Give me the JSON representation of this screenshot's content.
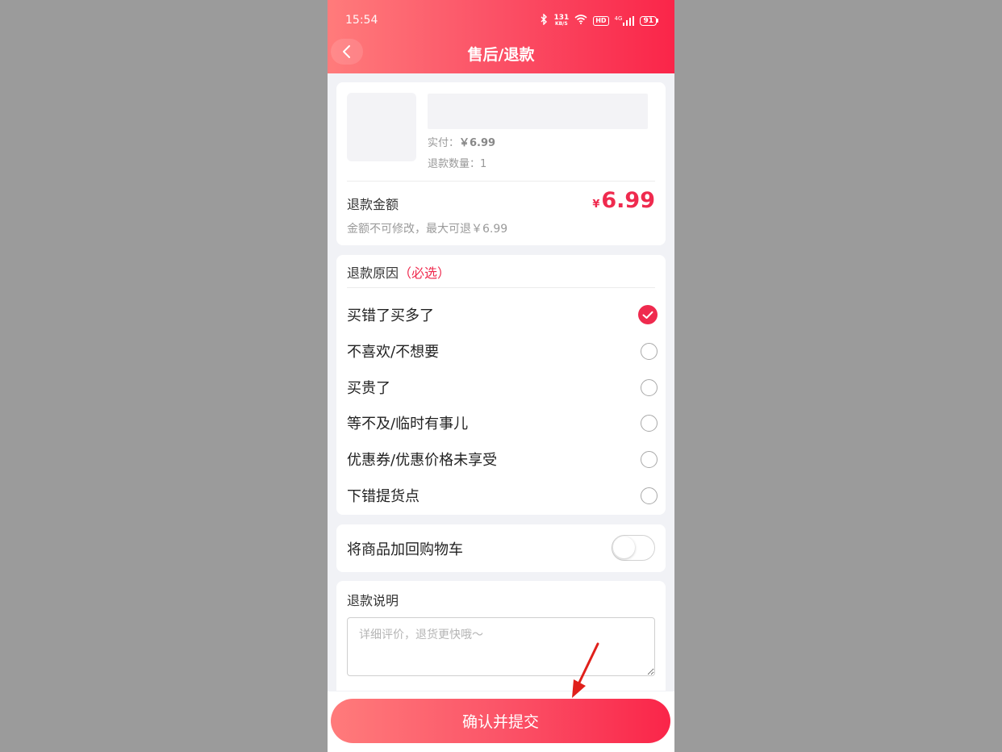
{
  "status_bar": {
    "time": "15:54",
    "net_speed": "131",
    "net_unit": "KB/S",
    "hd": "HD",
    "signal": "4G",
    "battery": "91"
  },
  "header": {
    "title": "售后/退款",
    "back_icon": "chevron-left-icon"
  },
  "product": {
    "paid_label": "实付：",
    "paid_value": "￥6.99",
    "qty_label": "退款数量：",
    "qty_value": "1"
  },
  "refund": {
    "label": "退款金额",
    "currency": "¥",
    "amount": "6.99",
    "note": "金额不可修改，最大可退￥6.99"
  },
  "reason": {
    "title": "退款原因",
    "required": "（必选）",
    "options": [
      {
        "label": "买错了买多了",
        "checked": true
      },
      {
        "label": "不喜欢/不想要",
        "checked": false
      },
      {
        "label": "买贵了",
        "checked": false
      },
      {
        "label": "等不及/临时有事儿",
        "checked": false
      },
      {
        "label": "优惠券/优惠价格未享受",
        "checked": false
      },
      {
        "label": "下错提货点",
        "checked": false
      }
    ]
  },
  "cart": {
    "label": "将商品加回购物车",
    "enabled": false
  },
  "description": {
    "label": "退款说明",
    "placeholder": "详细评价，退货更快哦～"
  },
  "submit": {
    "label": "确认并提交"
  },
  "colors": {
    "accent": "#ef2a4e",
    "gradient_start": "#ff7b7b",
    "gradient_end": "#fa2549",
    "annotation_arrow": "#e0201b"
  }
}
